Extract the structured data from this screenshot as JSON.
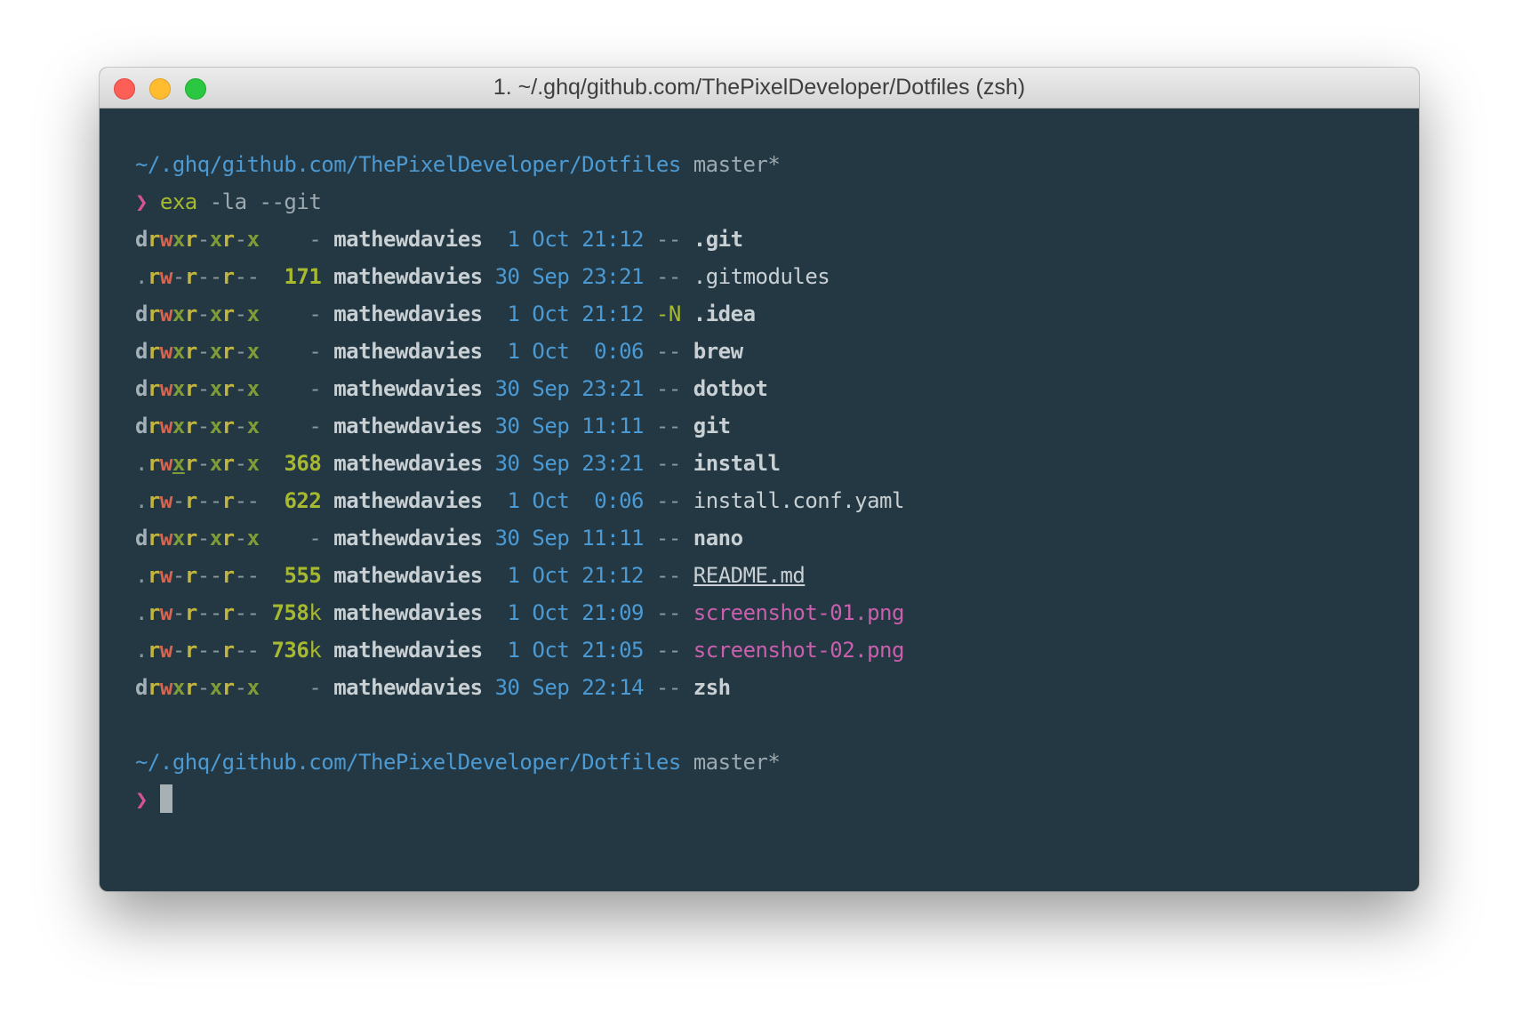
{
  "window": {
    "title": "1. ~/.ghq/github.com/ThePixelDeveloper/Dotfiles (zsh)"
  },
  "colors": {
    "terminal_bg": "#243843",
    "path": "#4c9ad3",
    "prompt": "#d55496",
    "command": "#a7b92e",
    "image_file": "#ca5fae"
  },
  "prompt1": {
    "path": "~/.ghq/github.com/ThePixelDeveloper/Dotfiles",
    "branch": "master*",
    "symbol": "❯",
    "command": "exa",
    "args": "-la --git"
  },
  "listing": [
    {
      "perm_type": "d",
      "perm_bits": "rwxr-xr-x",
      "size": "-",
      "user": "mathewdavies",
      "day": "1",
      "month": "Oct",
      "time": "21:12",
      "git": "--",
      "name": ".git",
      "kind": "dir"
    },
    {
      "perm_type": ".",
      "perm_bits": "rw-r--r--",
      "size": "171",
      "user": "mathewdavies",
      "day": "30",
      "month": "Sep",
      "time": "23:21",
      "git": "--",
      "name": ".gitmodules",
      "kind": "file"
    },
    {
      "perm_type": "d",
      "perm_bits": "rwxr-xr-x",
      "size": "-",
      "user": "mathewdavies",
      "day": "1",
      "month": "Oct",
      "time": "21:12",
      "git": "-N",
      "name": ".idea",
      "kind": "dir"
    },
    {
      "perm_type": "d",
      "perm_bits": "rwxr-xr-x",
      "size": "-",
      "user": "mathewdavies",
      "day": "1",
      "month": "Oct",
      "time": "0:06",
      "git": "--",
      "name": "brew",
      "kind": "dir"
    },
    {
      "perm_type": "d",
      "perm_bits": "rwxr-xr-x",
      "size": "-",
      "user": "mathewdavies",
      "day": "30",
      "month": "Sep",
      "time": "23:21",
      "git": "--",
      "name": "dotbot",
      "kind": "dir"
    },
    {
      "perm_type": "d",
      "perm_bits": "rwxr-xr-x",
      "size": "-",
      "user": "mathewdavies",
      "day": "30",
      "month": "Sep",
      "time": "11:11",
      "git": "--",
      "name": "git",
      "kind": "dir"
    },
    {
      "perm_type": ".",
      "perm_bits": "rwxr-xr-x",
      "size": "368",
      "user": "mathewdavies",
      "day": "30",
      "month": "Sep",
      "time": "23:21",
      "git": "--",
      "name": "install",
      "kind": "exec"
    },
    {
      "perm_type": ".",
      "perm_bits": "rw-r--r--",
      "size": "622",
      "user": "mathewdavies",
      "day": "1",
      "month": "Oct",
      "time": "0:06",
      "git": "--",
      "name": "install.conf.yaml",
      "kind": "file"
    },
    {
      "perm_type": "d",
      "perm_bits": "rwxr-xr-x",
      "size": "-",
      "user": "mathewdavies",
      "day": "30",
      "month": "Sep",
      "time": "11:11",
      "git": "--",
      "name": "nano",
      "kind": "dir"
    },
    {
      "perm_type": ".",
      "perm_bits": "rw-r--r--",
      "size": "555",
      "user": "mathewdavies",
      "day": "1",
      "month": "Oct",
      "time": "21:12",
      "git": "--",
      "name": "README.md",
      "kind": "readme"
    },
    {
      "perm_type": ".",
      "perm_bits": "rw-r--r--",
      "size": "758k",
      "user": "mathewdavies",
      "day": "1",
      "month": "Oct",
      "time": "21:09",
      "git": "--",
      "name": "screenshot-01.png",
      "kind": "image"
    },
    {
      "perm_type": ".",
      "perm_bits": "rw-r--r--",
      "size": "736k",
      "user": "mathewdavies",
      "day": "1",
      "month": "Oct",
      "time": "21:05",
      "git": "--",
      "name": "screenshot-02.png",
      "kind": "image"
    },
    {
      "perm_type": "d",
      "perm_bits": "rwxr-xr-x",
      "size": "-",
      "user": "mathewdavies",
      "day": "30",
      "month": "Sep",
      "time": "22:14",
      "git": "--",
      "name": "zsh",
      "kind": "dir"
    }
  ],
  "prompt2": {
    "path": "~/.ghq/github.com/ThePixelDeveloper/Dotfiles",
    "branch": "master*",
    "symbol": "❯"
  }
}
